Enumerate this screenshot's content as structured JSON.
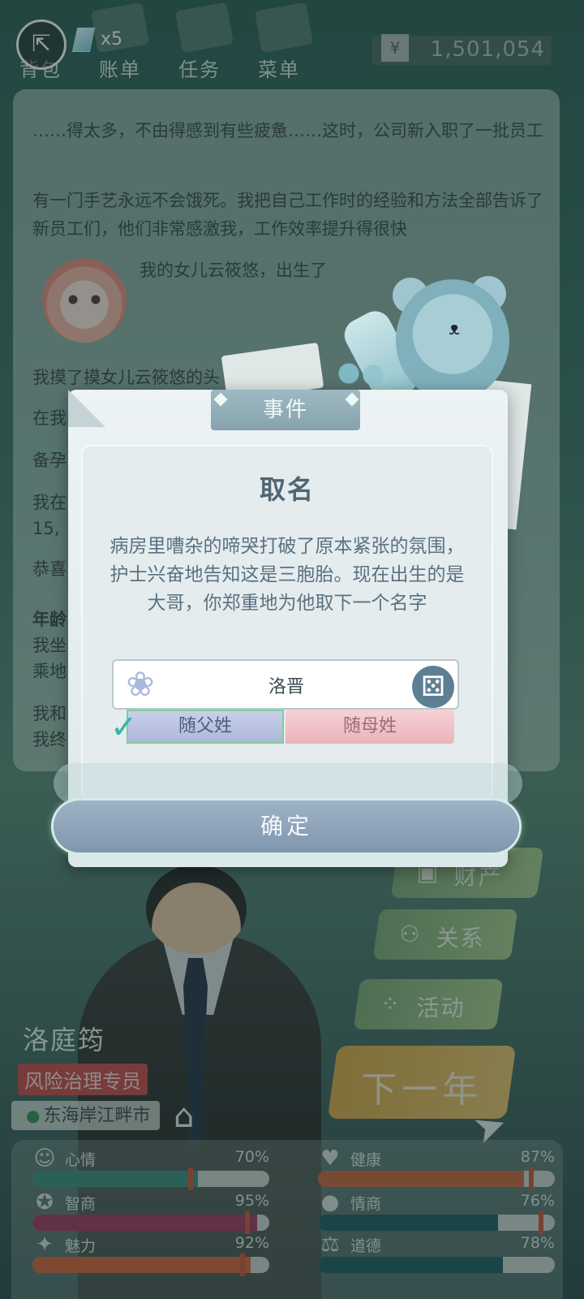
{
  "topbar": {
    "gem_count": "x5",
    "tabs": [
      "背包",
      "账单",
      "任务",
      "菜单"
    ],
    "currency_symbol": "¥",
    "money": "1,501,054"
  },
  "story": {
    "p1": "……得太多，不由得感到有些疲惫……这时，公司新入职了一批员工",
    "p2": "有一门手艺永远不会饿死。我把自己工作时的经验和方法全部告诉了新员工们，他们非常感激我，工作效率提升得很快",
    "birth": "我的女儿云筱悠，出生了",
    "p3": "我摸了摸女儿云筱悠的头",
    "p4": "在我的",
    "p5": "备孕",
    "p6": "我在",
    "p6b": "15,",
    "p7": "恭喜",
    "p8": "年龄",
    "p9": "我坐",
    "p9b": "乘地",
    "p10": "我和",
    "p10b": "我终"
  },
  "side_buttons": [
    {
      "label": "财产",
      "icon": "wallet-icon"
    },
    {
      "label": "关系",
      "icon": "people-icon"
    },
    {
      "label": "活动",
      "icon": "activity-icon"
    }
  ],
  "next_year": "下一年",
  "player": {
    "name": "洛庭筠",
    "job": "风险治理专员",
    "location": "东海岸江畔市"
  },
  "stats": [
    {
      "label": "心情",
      "value": "70%",
      "fill": 0.7,
      "color": "#3f8f83"
    },
    {
      "label": "健康",
      "value": "87%",
      "fill": 0.87,
      "color": "#c9673f"
    },
    {
      "label": "智商",
      "value": "95%",
      "fill": 0.95,
      "color": "#a23a63"
    },
    {
      "label": "情商",
      "value": "76%",
      "fill": 0.76,
      "color": "#1f5e63"
    },
    {
      "label": "魅力",
      "value": "92%",
      "fill": 0.92,
      "color": "#d5643a"
    },
    {
      "label": "道德",
      "value": "78%",
      "fill": 0.78,
      "color": "#1f5e63"
    }
  ],
  "modal": {
    "tab": "事件",
    "title": "取名",
    "text": "病房里嘈杂的啼哭打破了原本紧张的氛围，护士兴奋地告知这是三胞胎。现在出生的是大哥，你郑重地为他取下一个名字",
    "name_value": "洛晋",
    "surname_father": "随父姓",
    "surname_mother": "随母姓",
    "confirm": "确定"
  }
}
